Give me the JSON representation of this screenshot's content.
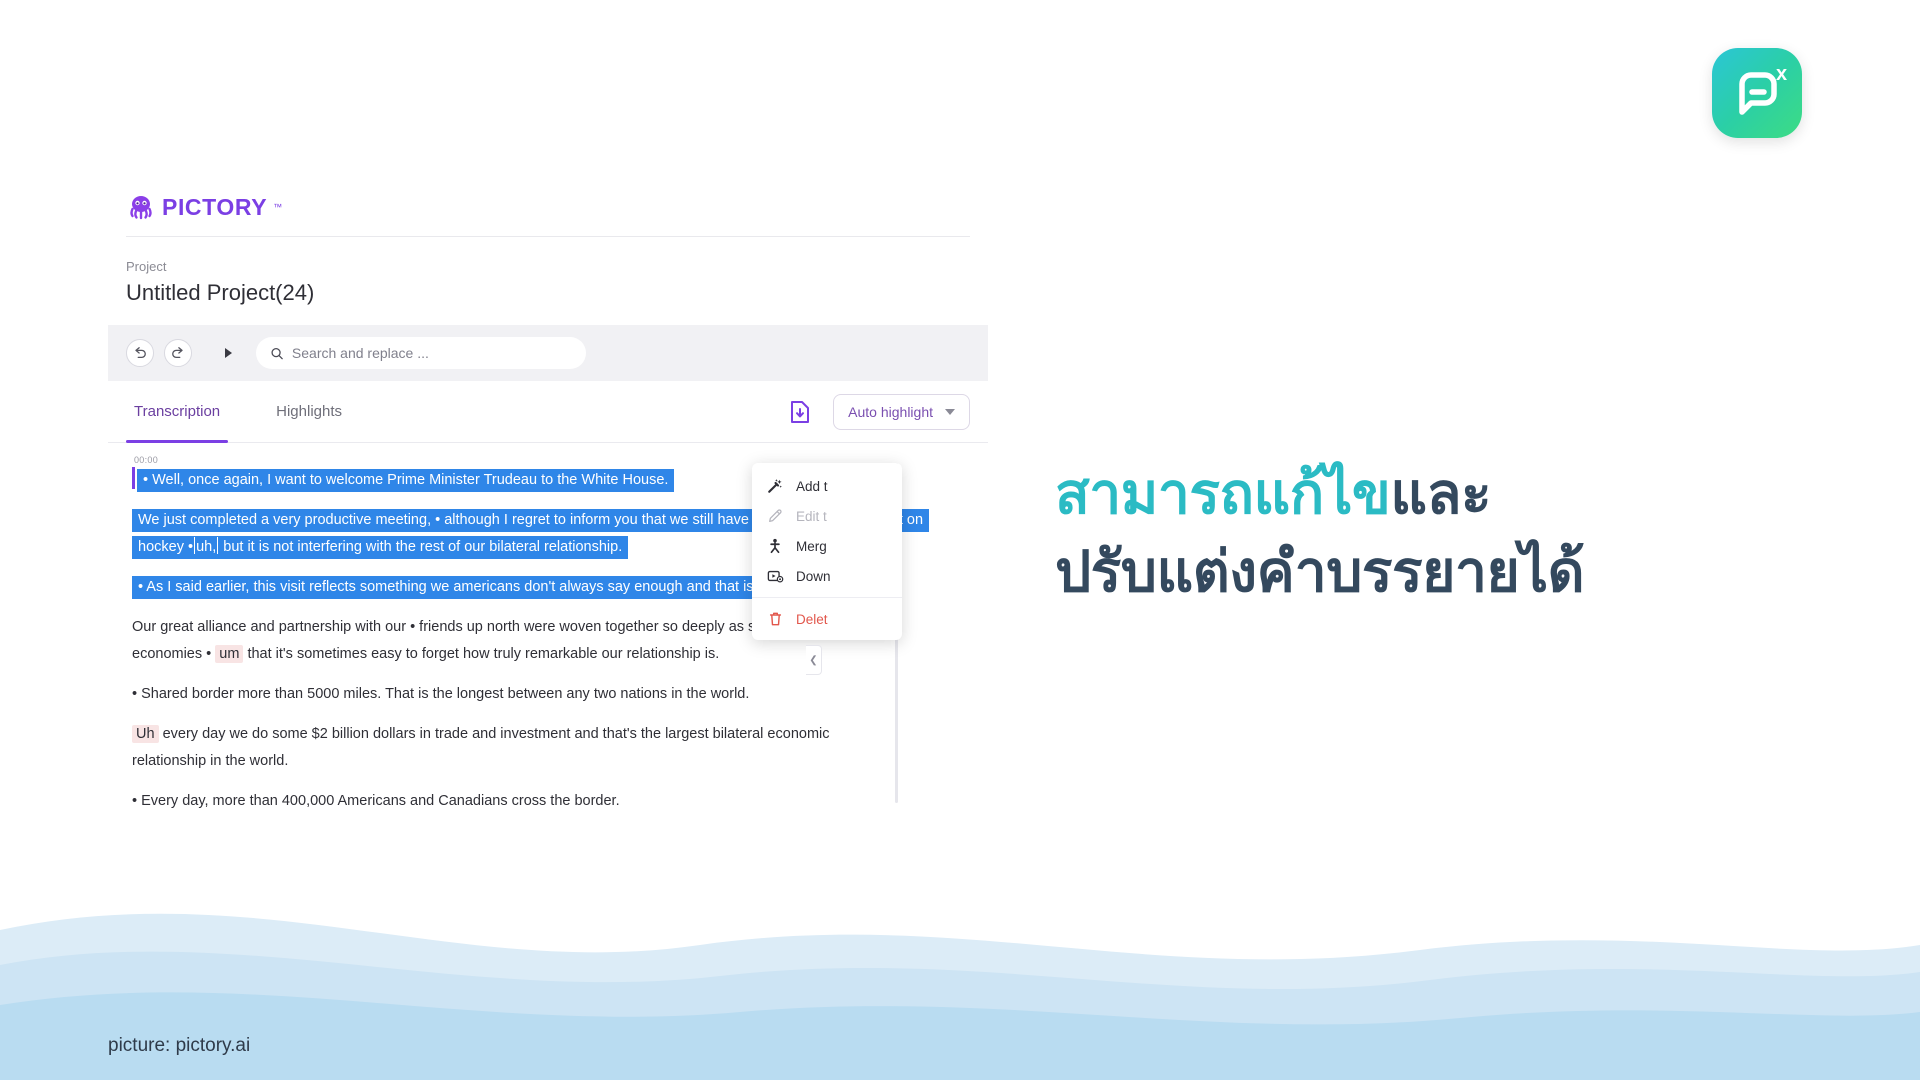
{
  "brand": {
    "badge_icon": "pictory-p-logo-icon",
    "badge_superscript": "x"
  },
  "app": {
    "logo_text": "PICTORY",
    "logo_tm": "™",
    "logo_icon": "octopus-logo-icon",
    "project_label": "Project",
    "project_title": "Untitled Project(24)",
    "toolbar": {
      "undo_icon": "undo-icon",
      "redo_icon": "redo-icon",
      "play_icon": "play-triangle-icon",
      "search_icon": "search-icon",
      "search_placeholder": "Search and replace ...",
      "search_value": ""
    },
    "tabs": [
      {
        "label": "Transcription",
        "active": true
      },
      {
        "label": "Highlights",
        "active": false
      }
    ],
    "tab_actions": {
      "download_icon": "download-document-icon",
      "auto_highlight_label": "Auto highlight",
      "auto_highlight_chevron": "chevron-down-icon"
    },
    "transcript": {
      "timecode": "00:00",
      "paragraphs": [
        {
          "selected": true,
          "text": "• Well, once again, I want to welcome Prime Minister Trudeau to the White House."
        },
        {
          "selected": true,
          "text_before_filler": "We just completed a very productive meeting, • although I regret to inform you that we still have not reached agreement on hockey •",
          "filler": "uh,",
          "text_after_filler": "but it is not interfering with the rest of our bilateral relationship."
        },
        {
          "selected": true,
          "text": "• As I said earlier, this visit reflects something we americans don't always say enough and that is how much we value."
        },
        {
          "selected": false,
          "text_before_filler": "Our great alliance and partnership with our • friends up north were woven together so deeply as societies, as economies •",
          "filler": "um",
          "text_after_filler": "that it's sometimes easy to forget how truly remarkable our relationship is."
        },
        {
          "selected": false,
          "text": "• Shared border more than 5000 miles. That is the longest between any two nations in the world."
        },
        {
          "selected": false,
          "filler_leading": "Uh",
          "text_after_filler": "every day we do some $2 billion dollars in trade and investment and that's the largest bilateral economic relationship in the world."
        },
        {
          "selected": false,
          "text": "• Every day, more than 400,000 Americans and Canadians cross the border."
        }
      ]
    },
    "context_menu": {
      "items": [
        {
          "label": "Add t",
          "icon": "magic-wand-icon",
          "state": "enabled"
        },
        {
          "label": "Edit t",
          "icon": "pencil-icon",
          "state": "disabled"
        },
        {
          "label": "Merg",
          "icon": "merge-person-icon",
          "state": "enabled"
        },
        {
          "label": "Down",
          "icon": "video-settings-icon",
          "state": "enabled"
        },
        {
          "label": "Delet",
          "icon": "trash-icon",
          "state": "danger"
        }
      ],
      "collapse_icon": "chevron-left-icon"
    }
  },
  "headline": {
    "line1_teal": "สามารถแก้ไข",
    "line1_navy": "และ",
    "line2": "ปรับแต่งคำบรรยายได้"
  },
  "footer": {
    "caption": "picture: pictory.ai"
  },
  "colors": {
    "brand_purple": "#7B3FE4",
    "selection_blue": "#2f86e8",
    "filler_pink": "#f8e4e4",
    "headline_teal": "#2BBBC4",
    "headline_navy": "#34495E",
    "danger_red": "#e2574c"
  }
}
